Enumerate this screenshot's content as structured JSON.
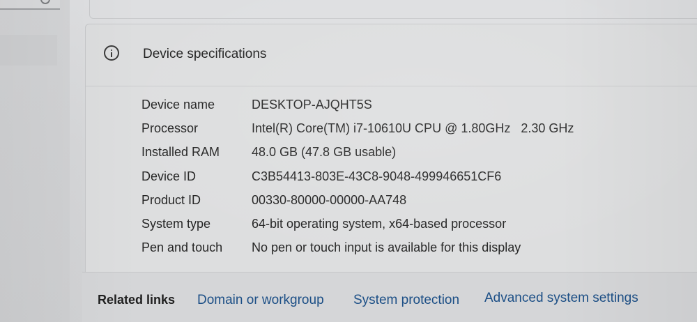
{
  "spec_section": {
    "title": "Device specifications",
    "rows": [
      {
        "label": "Device name",
        "value": "DESKTOP-AJQHT5S"
      },
      {
        "label": "Processor",
        "value": "Intel(R) Core(TM) i7-10610U CPU @ 1.80GHz   2.30 GHz"
      },
      {
        "label": "Installed RAM",
        "value": "48.0 GB (47.8 GB usable)"
      },
      {
        "label": "Device ID",
        "value": "C3B54413-803E-43C8-9048-499946651CF6"
      },
      {
        "label": "Product ID",
        "value": "00330-80000-00000-AA748"
      },
      {
        "label": "System type",
        "value": "64-bit operating system, x64-based processor"
      },
      {
        "label": "Pen and touch",
        "value": "No pen or touch input is available for this display"
      }
    ]
  },
  "related_links": {
    "title": "Related links",
    "links": [
      {
        "label": "Domain or workgroup"
      },
      {
        "label": "System protection"
      },
      {
        "label": "Advanced system settings"
      }
    ]
  },
  "icons": {
    "info": "info-icon",
    "search": "search-icon"
  },
  "colors": {
    "link": "#1c4f86",
    "text": "#252525",
    "card_background": "#dddedf"
  }
}
